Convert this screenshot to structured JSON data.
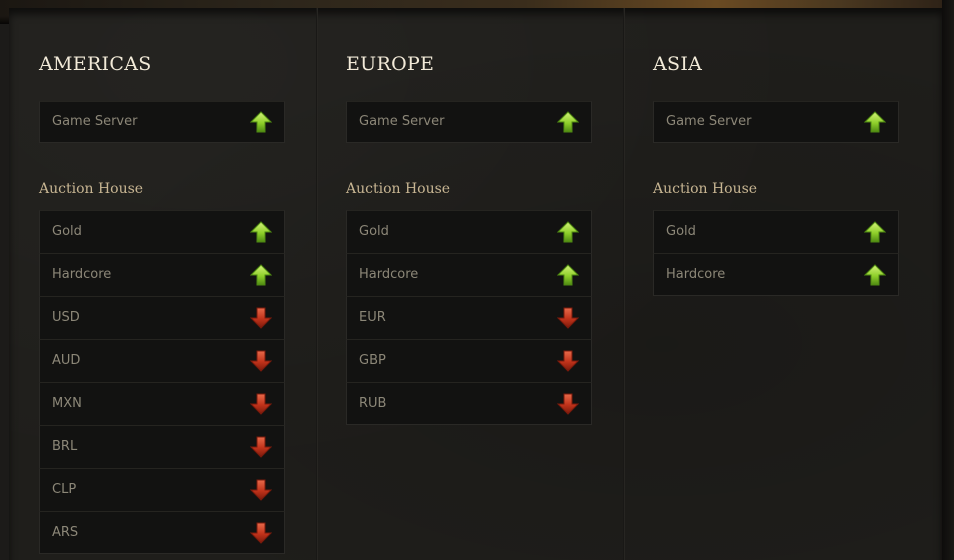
{
  "colors": {
    "up": "#8fcf2a",
    "down": "#c0321a",
    "title": "#f2ead8",
    "section_title": "#c7b592",
    "row_text": "#8c8778"
  },
  "regions": [
    {
      "name": "AMERICAS",
      "game_server": {
        "label": "Game Server",
        "status": "up"
      },
      "auction_house_title": "Auction House",
      "auction_house": [
        {
          "label": "Gold",
          "status": "up"
        },
        {
          "label": "Hardcore",
          "status": "up"
        },
        {
          "label": "USD",
          "status": "down"
        },
        {
          "label": "AUD",
          "status": "down"
        },
        {
          "label": "MXN",
          "status": "down"
        },
        {
          "label": "BRL",
          "status": "down"
        },
        {
          "label": "CLP",
          "status": "down"
        },
        {
          "label": "ARS",
          "status": "down"
        }
      ]
    },
    {
      "name": "EUROPE",
      "game_server": {
        "label": "Game Server",
        "status": "up"
      },
      "auction_house_title": "Auction House",
      "auction_house": [
        {
          "label": "Gold",
          "status": "up"
        },
        {
          "label": "Hardcore",
          "status": "up"
        },
        {
          "label": "EUR",
          "status": "down"
        },
        {
          "label": "GBP",
          "status": "down"
        },
        {
          "label": "RUB",
          "status": "down"
        }
      ]
    },
    {
      "name": "ASIA",
      "game_server": {
        "label": "Game Server",
        "status": "up"
      },
      "auction_house_title": "Auction House",
      "auction_house": [
        {
          "label": "Gold",
          "status": "up"
        },
        {
          "label": "Hardcore",
          "status": "up"
        }
      ]
    }
  ],
  "icons": {
    "up": "arrow-up-green-icon",
    "down": "arrow-down-red-icon"
  }
}
